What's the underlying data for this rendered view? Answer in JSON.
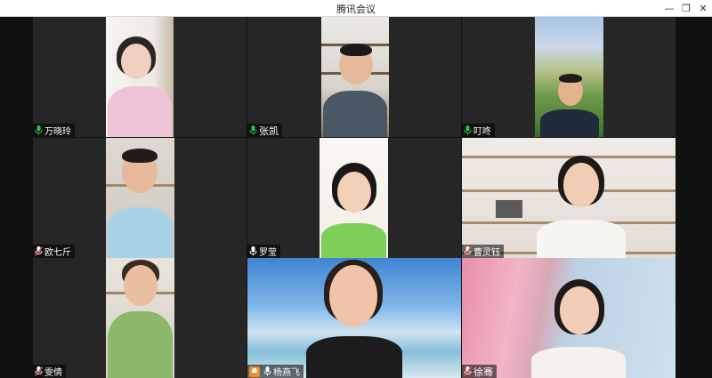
{
  "window": {
    "title": "腾讯会议",
    "minimize_glyph": "—",
    "restore_glyph": "❐",
    "close_glyph": "✕"
  },
  "colors": {
    "mic_active": "#2fbd4a",
    "mic_muted": "#ff4d4f",
    "host_badge": "#f28c28"
  },
  "participants": [
    {
      "name": "万晓玲",
      "mic": "active",
      "host": false
    },
    {
      "name": "张凯",
      "mic": "active",
      "host": false
    },
    {
      "name": "叮咚",
      "mic": "active",
      "host": false
    },
    {
      "name": "欧七斤",
      "mic": "muted",
      "host": false
    },
    {
      "name": "罗莹",
      "mic": "active",
      "host": false
    },
    {
      "name": "曹灵钰",
      "mic": "muted",
      "host": false
    },
    {
      "name": "雯倩",
      "mic": "muted",
      "host": false
    },
    {
      "name": "杨燕飞",
      "mic": "active",
      "host": true
    },
    {
      "name": "徐骞",
      "mic": "muted",
      "host": false
    }
  ]
}
